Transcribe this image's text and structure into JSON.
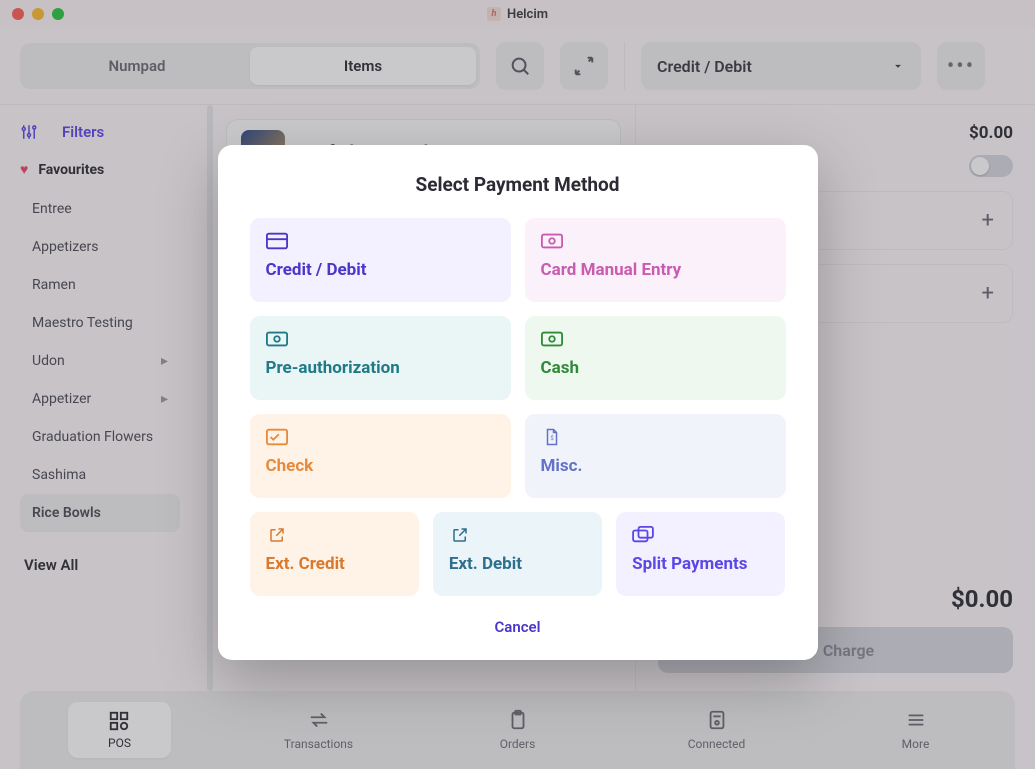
{
  "window": {
    "title": "Helcim"
  },
  "toolbar": {
    "tabs": {
      "numpad": "Numpad",
      "items": "Items"
    },
    "payment_dropdown": {
      "selected": "Credit / Debit"
    }
  },
  "sidebar": {
    "filters_label": "Filters",
    "favourites_label": "Favourites",
    "categories": [
      {
        "label": "Entree",
        "has_submenu": false,
        "active": false
      },
      {
        "label": "Appetizers",
        "has_submenu": false,
        "active": false
      },
      {
        "label": "Ramen",
        "has_submenu": false,
        "active": false
      },
      {
        "label": "Maestro Testing",
        "has_submenu": false,
        "active": false
      },
      {
        "label": "Udon",
        "has_submenu": true,
        "active": false
      },
      {
        "label": "Appetizer",
        "has_submenu": true,
        "active": false
      },
      {
        "label": "Graduation Flowers",
        "has_submenu": false,
        "active": false
      },
      {
        "label": "Sashima",
        "has_submenu": false,
        "active": false
      },
      {
        "label": "Rice Bowls",
        "has_submenu": false,
        "active": true
      }
    ],
    "view_all": "View All"
  },
  "items_list": {
    "items": [
      {
        "name": "Beef Chasu Bowl"
      }
    ]
  },
  "ticket": {
    "subtotal": "$0.00",
    "lines_placeholder_1": "–",
    "total": "$0.00",
    "charge_label": "Charge"
  },
  "tabbar": {
    "pos": "POS",
    "transactions": "Transactions",
    "orders": "Orders",
    "connected": "Connected",
    "more": "More"
  },
  "modal": {
    "title": "Select Payment Method",
    "methods": {
      "credit_debit": "Credit / Debit",
      "card_manual": "Card Manual Entry",
      "preauth": "Pre-authorization",
      "cash": "Cash",
      "check": "Check",
      "misc": "Misc.",
      "ext_credit": "Ext. Credit",
      "ext_debit": "Ext. Debit",
      "split": "Split Payments"
    },
    "cancel": "Cancel"
  }
}
